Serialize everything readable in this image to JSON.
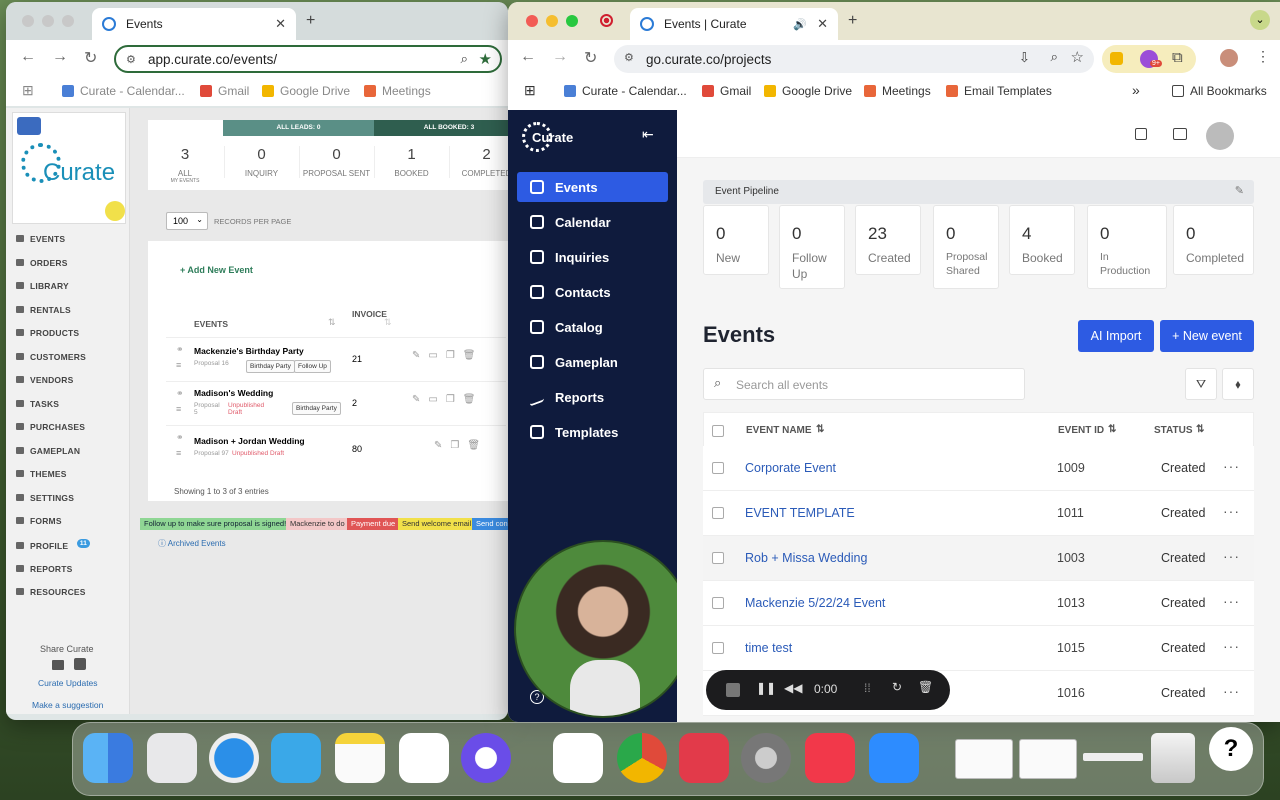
{
  "left_window": {
    "tab_title": "Events",
    "url": "app.curate.co/events/",
    "bookmarks": [
      "Curate - Calendar...",
      "Gmail",
      "Google Drive",
      "Meetings"
    ],
    "logo_text": "Curate",
    "sidebar": [
      "EVENTS",
      "ORDERS",
      "LIBRARY",
      "RENTALS",
      "PRODUCTS",
      "CUSTOMERS",
      "VENDORS",
      "TASKS",
      "PURCHASES",
      "GAMEPLAN",
      "THEMES",
      "SETTINGS",
      "FORMS",
      "PROFILE",
      "REPORTS",
      "RESOURCES"
    ],
    "profile_badge": "11",
    "share_title": "Share Curate",
    "curate_updates": "Curate Updates",
    "suggestion": "Make a suggestion",
    "all_leads": "ALL LEADS: 0",
    "all_booked": "ALL BOOKED: 3",
    "stats": [
      {
        "value": "3",
        "label": "ALL",
        "sub": "MY EVENTS"
      },
      {
        "value": "0",
        "label": "INQUIRY"
      },
      {
        "value": "0",
        "label": "PROPOSAL SENT"
      },
      {
        "value": "1",
        "label": "BOOKED"
      },
      {
        "value": "2",
        "label": "COMPLETED"
      }
    ],
    "records_value": "100",
    "records_label": "RECORDS PER PAGE",
    "add_new": "+ Add New Event",
    "col_events": "EVENTS",
    "col_invoice": "INVOICE",
    "rows": [
      {
        "name": "Mackenzie's Birthday Party",
        "sub": "Proposal 16",
        "draft": "",
        "tags": [
          "Birthday Party",
          "Follow Up"
        ],
        "invoice": "21"
      },
      {
        "name": "Madison's Wedding",
        "sub": "Proposal 5",
        "draft": "Unpublished Draft",
        "tags": [
          "Birthday Party"
        ],
        "invoice": "2"
      },
      {
        "name": "Madison + Jordan Wedding",
        "sub": "Proposal 97",
        "draft": "Unpublished Draft",
        "tags": [],
        "invoice": "80"
      }
    ],
    "showing": "Showing 1 to 3 of 3 entries",
    "pills": [
      {
        "text": "Follow up to make sure proposal is signed!",
        "bg": "#8fd694",
        "fg": "#123"
      },
      {
        "text": "Mackenzie to do",
        "bg": "#f3c7c7",
        "fg": "#333"
      },
      {
        "text": "Payment due",
        "bg": "#e05555",
        "fg": "#fff"
      },
      {
        "text": "Send welcome email",
        "bg": "#f1e04a",
        "fg": "#333"
      },
      {
        "text": "Send con",
        "bg": "#3b8be0",
        "fg": "#fff"
      }
    ],
    "archived": "Archived Events"
  },
  "right_window": {
    "tab_title": "Events | Curate",
    "url": "go.curate.co/projects",
    "bookmarks": [
      "Curate - Calendar...",
      "Gmail",
      "Google Drive",
      "Meetings",
      "Email Templates"
    ],
    "all_bookmarks": "All Bookmarks",
    "ext_badge": "9+",
    "brand": "Curate",
    "nav": [
      "Events",
      "Calendar",
      "Inquiries",
      "Contacts",
      "Catalog",
      "Gameplan",
      "Reports",
      "Templates"
    ],
    "pipeline_title": "Event Pipeline",
    "pipeline": [
      {
        "value": "0",
        "label": "New"
      },
      {
        "value": "0",
        "label": "Follow Up"
      },
      {
        "value": "23",
        "label": "Created"
      },
      {
        "value": "0",
        "label": "Proposal Shared"
      },
      {
        "value": "4",
        "label": "Booked"
      },
      {
        "value": "0",
        "label": "In Production"
      },
      {
        "value": "0",
        "label": "Completed"
      }
    ],
    "events_heading": "Events",
    "ai_import": "AI Import",
    "new_event": "+ New event",
    "search_placeholder": "Search all events",
    "col_name": "EVENT NAME",
    "col_id": "EVENT ID",
    "col_status": "STATUS",
    "rows": [
      {
        "name": "Corporate Event",
        "id": "1009",
        "status": "Created"
      },
      {
        "name": "EVENT TEMPLATE",
        "id": "1011",
        "status": "Created"
      },
      {
        "name": "Rob + Missa Wedding",
        "id": "1003",
        "status": "Created"
      },
      {
        "name": "Mackenzie 5/22/24 Event",
        "id": "1013",
        "status": "Created"
      },
      {
        "name": "time test",
        "id": "1015",
        "status": "Created"
      },
      {
        "name": "",
        "id": "1016",
        "status": "Created"
      }
    ],
    "recorder_time": "0:00"
  },
  "dock": [
    "Finder",
    "Launchpad",
    "Safari",
    "Xcode Tools",
    "Notes",
    "Freeform",
    "Perplexity",
    "Slack",
    "Chrome",
    "Expensify",
    "System Settings",
    "Music",
    "Zoom",
    "Window 1",
    "Window 2",
    "Chrome Window",
    "Trash",
    "Help"
  ],
  "colors": {
    "accent": "#2d5be3",
    "sidebar_dark": "#0f1b3d",
    "teal_header": "#5a8f86"
  }
}
